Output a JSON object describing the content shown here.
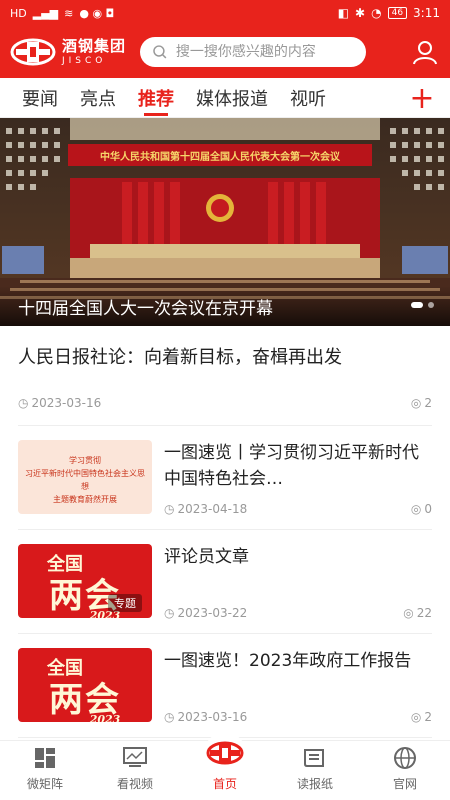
{
  "status_bar": {
    "left": "HD",
    "battery": "46",
    "time": "3:11"
  },
  "header": {
    "brand_cn": "酒钢集团",
    "brand_en": "JISCO",
    "search_placeholder": "搜一搜你感兴趣的内容"
  },
  "tabs": [
    {
      "label": "要闻"
    },
    {
      "label": "亮点"
    },
    {
      "label": "推荐",
      "active": true
    },
    {
      "label": "媒体报道"
    },
    {
      "label": "视听"
    }
  ],
  "banner": {
    "caption": "十四届全国人大一次会议在京开幕",
    "stage_banner": "中华人民共和国第十四届全国人民代表大会第一次会议"
  },
  "lead": {
    "title": "人民日报社论：向着新目标，奋楫再出发",
    "date": "2023-03-16",
    "views": "2"
  },
  "items": [
    {
      "title": "一图速览丨学习贯彻习近平新时代中国特色社会…",
      "date": "2023-04-18",
      "views": "0",
      "thumb": "xi",
      "thumb_text": [
        "学习贯彻",
        "习近平新时代中国特色社会主义思想",
        "主题教育蔚然开展"
      ]
    },
    {
      "title": "评论员文章",
      "date": "2023-03-22",
      "views": "22",
      "thumb": "lianghui",
      "tag": "专题",
      "thumb_text": [
        "全国",
        "两会",
        "2023"
      ]
    },
    {
      "title": "一图速览！2023年政府工作报告",
      "date": "2023-03-16",
      "views": "2",
      "thumb": "lianghui",
      "thumb_text": [
        "全国",
        "两会",
        "2023"
      ]
    }
  ],
  "bottom_nav": [
    {
      "label": "微矩阵",
      "icon": "grid-icon"
    },
    {
      "label": "看视频",
      "icon": "video-icon"
    },
    {
      "label": "首页",
      "icon": "home-logo-icon",
      "active": true
    },
    {
      "label": "读报纸",
      "icon": "newspaper-icon"
    },
    {
      "label": "官网",
      "icon": "globe-icon"
    }
  ],
  "colors": {
    "accent": "#e8231c"
  }
}
